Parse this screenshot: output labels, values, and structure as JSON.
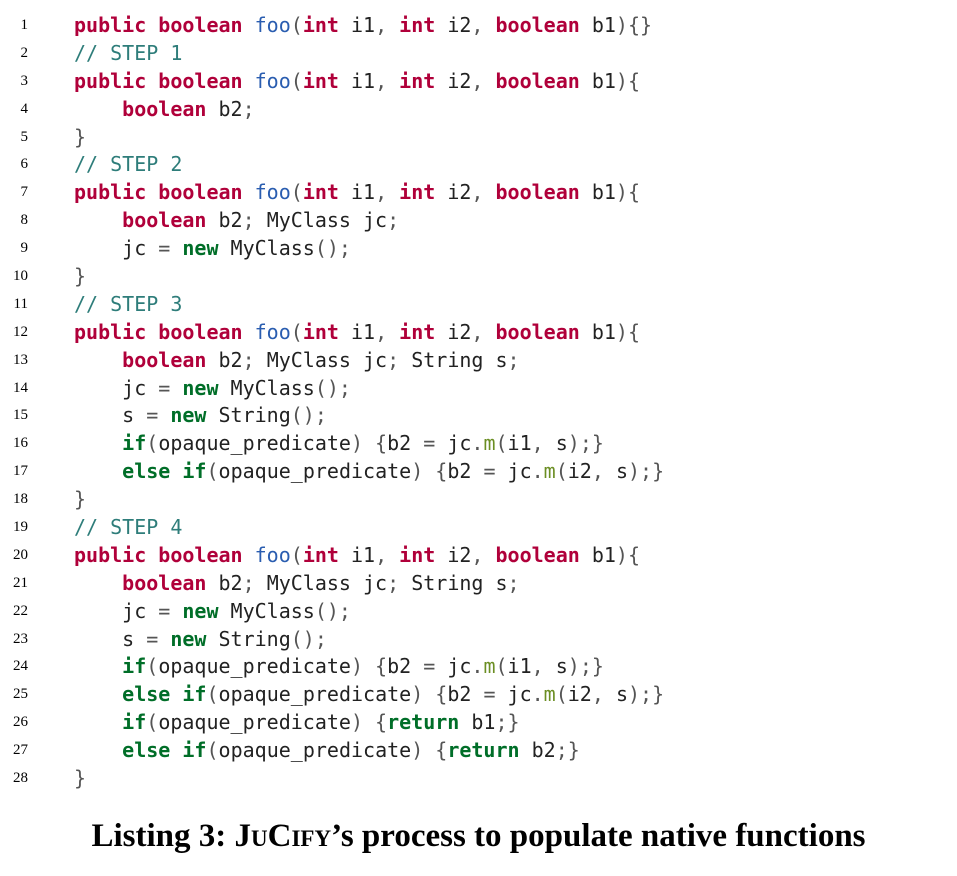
{
  "listing": {
    "lines": [
      {
        "n": "1",
        "tokens": [
          [
            "kw",
            "public"
          ],
          [
            "id",
            " "
          ],
          [
            "kw",
            "boolean"
          ],
          [
            "id",
            " "
          ],
          [
            "fn",
            "foo"
          ],
          [
            "pu",
            "("
          ],
          [
            "kw",
            "int"
          ],
          [
            "id",
            " i1"
          ],
          [
            "pu",
            ", "
          ],
          [
            "kw",
            "int"
          ],
          [
            "id",
            " i2"
          ],
          [
            "pu",
            ", "
          ],
          [
            "kw",
            "boolean"
          ],
          [
            "id",
            " b1"
          ],
          [
            "pu",
            "){}"
          ]
        ]
      },
      {
        "n": "2",
        "tokens": [
          [
            "cm",
            "// STEP 1"
          ]
        ]
      },
      {
        "n": "3",
        "tokens": [
          [
            "kw",
            "public"
          ],
          [
            "id",
            " "
          ],
          [
            "kw",
            "boolean"
          ],
          [
            "id",
            " "
          ],
          [
            "fn",
            "foo"
          ],
          [
            "pu",
            "("
          ],
          [
            "kw",
            "int"
          ],
          [
            "id",
            " i1"
          ],
          [
            "pu",
            ", "
          ],
          [
            "kw",
            "int"
          ],
          [
            "id",
            " i2"
          ],
          [
            "pu",
            ", "
          ],
          [
            "kw",
            "boolean"
          ],
          [
            "id",
            " b1"
          ],
          [
            "pu",
            "){"
          ]
        ]
      },
      {
        "n": "4",
        "tokens": [
          [
            "id",
            "    "
          ],
          [
            "kw",
            "boolean"
          ],
          [
            "id",
            " b2"
          ],
          [
            "pu",
            ";"
          ]
        ]
      },
      {
        "n": "5",
        "tokens": [
          [
            "pu",
            "}"
          ]
        ]
      },
      {
        "n": "6",
        "tokens": [
          [
            "cm",
            "// STEP 2"
          ]
        ]
      },
      {
        "n": "7",
        "tokens": [
          [
            "kw",
            "public"
          ],
          [
            "id",
            " "
          ],
          [
            "kw",
            "boolean"
          ],
          [
            "id",
            " "
          ],
          [
            "fn",
            "foo"
          ],
          [
            "pu",
            "("
          ],
          [
            "kw",
            "int"
          ],
          [
            "id",
            " i1"
          ],
          [
            "pu",
            ", "
          ],
          [
            "kw",
            "int"
          ],
          [
            "id",
            " i2"
          ],
          [
            "pu",
            ", "
          ],
          [
            "kw",
            "boolean"
          ],
          [
            "id",
            " b1"
          ],
          [
            "pu",
            "){"
          ]
        ]
      },
      {
        "n": "8",
        "tokens": [
          [
            "id",
            "    "
          ],
          [
            "kw",
            "boolean"
          ],
          [
            "id",
            " b2"
          ],
          [
            "pu",
            "; "
          ],
          [
            "id",
            "MyClass jc"
          ],
          [
            "pu",
            ";"
          ]
        ]
      },
      {
        "n": "9",
        "tokens": [
          [
            "id",
            "    jc "
          ],
          [
            "pu",
            "= "
          ],
          [
            "kw2",
            "new"
          ],
          [
            "id",
            " MyClass"
          ],
          [
            "pu",
            "();"
          ]
        ]
      },
      {
        "n": "10",
        "tokens": [
          [
            "pu",
            "}"
          ]
        ]
      },
      {
        "n": "11",
        "tokens": [
          [
            "cm",
            "// STEP 3"
          ]
        ]
      },
      {
        "n": "12",
        "tokens": [
          [
            "kw",
            "public"
          ],
          [
            "id",
            " "
          ],
          [
            "kw",
            "boolean"
          ],
          [
            "id",
            " "
          ],
          [
            "fn",
            "foo"
          ],
          [
            "pu",
            "("
          ],
          [
            "kw",
            "int"
          ],
          [
            "id",
            " i1"
          ],
          [
            "pu",
            ", "
          ],
          [
            "kw",
            "int"
          ],
          [
            "id",
            " i2"
          ],
          [
            "pu",
            ", "
          ],
          [
            "kw",
            "boolean"
          ],
          [
            "id",
            " b1"
          ],
          [
            "pu",
            "){"
          ]
        ]
      },
      {
        "n": "13",
        "tokens": [
          [
            "id",
            "    "
          ],
          [
            "kw",
            "boolean"
          ],
          [
            "id",
            " b2"
          ],
          [
            "pu",
            "; "
          ],
          [
            "id",
            "MyClass jc"
          ],
          [
            "pu",
            "; "
          ],
          [
            "id",
            "String s"
          ],
          [
            "pu",
            ";"
          ]
        ]
      },
      {
        "n": "14",
        "tokens": [
          [
            "id",
            "    jc "
          ],
          [
            "pu",
            "= "
          ],
          [
            "kw2",
            "new"
          ],
          [
            "id",
            " MyClass"
          ],
          [
            "pu",
            "();"
          ]
        ]
      },
      {
        "n": "15",
        "tokens": [
          [
            "id",
            "    s "
          ],
          [
            "pu",
            "= "
          ],
          [
            "kw2",
            "new"
          ],
          [
            "id",
            " String"
          ],
          [
            "pu",
            "();"
          ]
        ]
      },
      {
        "n": "16",
        "tokens": [
          [
            "id",
            "    "
          ],
          [
            "kw2",
            "if"
          ],
          [
            "pu",
            "("
          ],
          [
            "id",
            "opaque_predicate"
          ],
          [
            "pu",
            ") {"
          ],
          [
            "id",
            "b2 "
          ],
          [
            "pu",
            "= "
          ],
          [
            "id",
            "jc"
          ],
          [
            "pu",
            "."
          ],
          [
            "me",
            "m"
          ],
          [
            "pu",
            "("
          ],
          [
            "id",
            "i1"
          ],
          [
            "pu",
            ", "
          ],
          [
            "id",
            "s"
          ],
          [
            "pu",
            ");}"
          ]
        ]
      },
      {
        "n": "17",
        "tokens": [
          [
            "id",
            "    "
          ],
          [
            "kw2",
            "else"
          ],
          [
            "id",
            " "
          ],
          [
            "kw2",
            "if"
          ],
          [
            "pu",
            "("
          ],
          [
            "id",
            "opaque_predicate"
          ],
          [
            "pu",
            ") {"
          ],
          [
            "id",
            "b2 "
          ],
          [
            "pu",
            "= "
          ],
          [
            "id",
            "jc"
          ],
          [
            "pu",
            "."
          ],
          [
            "me",
            "m"
          ],
          [
            "pu",
            "("
          ],
          [
            "id",
            "i2"
          ],
          [
            "pu",
            ", "
          ],
          [
            "id",
            "s"
          ],
          [
            "pu",
            ");}"
          ]
        ]
      },
      {
        "n": "18",
        "tokens": [
          [
            "pu",
            "}"
          ]
        ]
      },
      {
        "n": "19",
        "tokens": [
          [
            "cm",
            "// STEP 4"
          ]
        ]
      },
      {
        "n": "20",
        "tokens": [
          [
            "kw",
            "public"
          ],
          [
            "id",
            " "
          ],
          [
            "kw",
            "boolean"
          ],
          [
            "id",
            " "
          ],
          [
            "fn",
            "foo"
          ],
          [
            "pu",
            "("
          ],
          [
            "kw",
            "int"
          ],
          [
            "id",
            " i1"
          ],
          [
            "pu",
            ", "
          ],
          [
            "kw",
            "int"
          ],
          [
            "id",
            " i2"
          ],
          [
            "pu",
            ", "
          ],
          [
            "kw",
            "boolean"
          ],
          [
            "id",
            " b1"
          ],
          [
            "pu",
            "){"
          ]
        ]
      },
      {
        "n": "21",
        "tokens": [
          [
            "id",
            "    "
          ],
          [
            "kw",
            "boolean"
          ],
          [
            "id",
            " b2"
          ],
          [
            "pu",
            "; "
          ],
          [
            "id",
            "MyClass jc"
          ],
          [
            "pu",
            "; "
          ],
          [
            "id",
            "String s"
          ],
          [
            "pu",
            ";"
          ]
        ]
      },
      {
        "n": "22",
        "tokens": [
          [
            "id",
            "    jc "
          ],
          [
            "pu",
            "= "
          ],
          [
            "kw2",
            "new"
          ],
          [
            "id",
            " MyClass"
          ],
          [
            "pu",
            "();"
          ]
        ]
      },
      {
        "n": "23",
        "tokens": [
          [
            "id",
            "    s "
          ],
          [
            "pu",
            "= "
          ],
          [
            "kw2",
            "new"
          ],
          [
            "id",
            " String"
          ],
          [
            "pu",
            "();"
          ]
        ]
      },
      {
        "n": "24",
        "tokens": [
          [
            "id",
            "    "
          ],
          [
            "kw2",
            "if"
          ],
          [
            "pu",
            "("
          ],
          [
            "id",
            "opaque_predicate"
          ],
          [
            "pu",
            ") {"
          ],
          [
            "id",
            "b2 "
          ],
          [
            "pu",
            "= "
          ],
          [
            "id",
            "jc"
          ],
          [
            "pu",
            "."
          ],
          [
            "me",
            "m"
          ],
          [
            "pu",
            "("
          ],
          [
            "id",
            "i1"
          ],
          [
            "pu",
            ", "
          ],
          [
            "id",
            "s"
          ],
          [
            "pu",
            ");}"
          ]
        ]
      },
      {
        "n": "25",
        "tokens": [
          [
            "id",
            "    "
          ],
          [
            "kw2",
            "else"
          ],
          [
            "id",
            " "
          ],
          [
            "kw2",
            "if"
          ],
          [
            "pu",
            "("
          ],
          [
            "id",
            "opaque_predicate"
          ],
          [
            "pu",
            ") {"
          ],
          [
            "id",
            "b2 "
          ],
          [
            "pu",
            "= "
          ],
          [
            "id",
            "jc"
          ],
          [
            "pu",
            "."
          ],
          [
            "me",
            "m"
          ],
          [
            "pu",
            "("
          ],
          [
            "id",
            "i2"
          ],
          [
            "pu",
            ", "
          ],
          [
            "id",
            "s"
          ],
          [
            "pu",
            ");}"
          ]
        ]
      },
      {
        "n": "26",
        "tokens": [
          [
            "id",
            "    "
          ],
          [
            "kw2",
            "if"
          ],
          [
            "pu",
            "("
          ],
          [
            "id",
            "opaque_predicate"
          ],
          [
            "pu",
            ") {"
          ],
          [
            "kw2",
            "return"
          ],
          [
            "id",
            " b1"
          ],
          [
            "pu",
            ";}"
          ]
        ]
      },
      {
        "n": "27",
        "tokens": [
          [
            "id",
            "    "
          ],
          [
            "kw2",
            "else"
          ],
          [
            "id",
            " "
          ],
          [
            "kw2",
            "if"
          ],
          [
            "pu",
            "("
          ],
          [
            "id",
            "opaque_predicate"
          ],
          [
            "pu",
            ") {"
          ],
          [
            "kw2",
            "return"
          ],
          [
            "id",
            " b2"
          ],
          [
            "pu",
            ";}"
          ]
        ]
      },
      {
        "n": "28",
        "tokens": [
          [
            "pu",
            "}"
          ]
        ]
      }
    ]
  },
  "caption": {
    "prefix": "Listing 3: ",
    "name": "JuCify",
    "suffix": "’s process to populate native functions"
  }
}
